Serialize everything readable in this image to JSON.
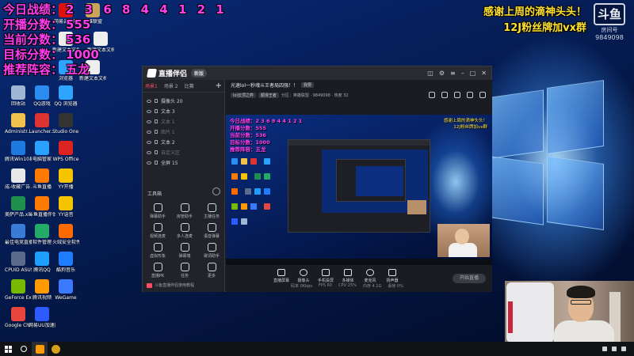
{
  "overlay_stats": [
    {
      "label": "今日战绩：",
      "value": "2 3 6 8 4 4 1 2 1"
    },
    {
      "label": "开播分数：",
      "value": "555"
    },
    {
      "label": "当前分数：",
      "value": "536"
    },
    {
      "label": "目标分数：",
      "value": "1000"
    },
    {
      "label": "推荐阵容：",
      "value": "五龙"
    }
  ],
  "overlay_thanks": [
    "感谢上周的滴神头头！",
    "12J粉丝牌加vx群"
  ],
  "watermark": {
    "brand": "斗鱼",
    "sub": "房间号",
    "room": "9849098"
  },
  "desktop_icons": [
    {
      "label": "回收站",
      "icon": "recycle-bin-icon",
      "color": "#9fb6d4"
    },
    {
      "label": "QQ游戏",
      "icon": "qq-game-icon",
      "color": "#2d8cf0"
    },
    {
      "label": "QQ 浏览器",
      "icon": "qq-browser-icon",
      "color": "#2fa4ff"
    },
    {
      "label": "Administr...",
      "icon": "user-folder-icon",
      "color": "#f0c14b"
    },
    {
      "label": "Launcher...",
      "icon": "launcher-icon",
      "color": "#d33"
    },
    {
      "label": "Studio One.exe",
      "icon": "studio-one-icon",
      "color": "#333"
    },
    {
      "label": "腾讯Win10易用",
      "icon": "tencent-icon",
      "color": "#1f7ae0"
    },
    {
      "label": "电脑管家",
      "icon": "pc-manager-icon",
      "color": "#2aa0ff"
    },
    {
      "label": "WPS Office",
      "icon": "wps-icon",
      "color": "#d22"
    },
    {
      "label": "成-收藏广告.xsks",
      "icon": "file-icon",
      "color": "#e8e8e8"
    },
    {
      "label": "斗鱼直播",
      "icon": "douyu-icon",
      "color": "#ff7a00"
    },
    {
      "label": "YY开播",
      "icon": "yy-icon",
      "color": "#f5c400"
    },
    {
      "label": "美萨产品.xls",
      "icon": "excel-icon",
      "color": "#1f8f4e"
    },
    {
      "label": "斗鱼直播伴侣",
      "icon": "douyu-companion-icon",
      "color": "#ff7a00"
    },
    {
      "label": "YY语音",
      "icon": "yy-voice-icon",
      "color": "#f5c400"
    },
    {
      "label": "最佳电竞直播产品库...022...",
      "icon": "doc-icon",
      "color": "#3a7bd5"
    },
    {
      "label": "软件管理",
      "icon": "software-icon",
      "color": "#22aa66"
    },
    {
      "label": "火绒安全软件",
      "icon": "huorong-icon",
      "color": "#ff6a00"
    },
    {
      "label": "CPUID ASUS CPU-Z",
      "icon": "cpuz-icon",
      "color": "#5a6b8c"
    },
    {
      "label": "腾讯QQ",
      "icon": "qq-icon",
      "color": "#1e9fff"
    },
    {
      "label": "酷狗音乐",
      "icon": "kugou-icon",
      "color": "#1e7cff"
    },
    {
      "label": "GeForce Experience",
      "icon": "geforce-icon",
      "color": "#76b900"
    },
    {
      "label": "腾讯视频",
      "icon": "tencent-video-icon",
      "color": "#ff9a00"
    },
    {
      "label": "WeGame",
      "icon": "wegame-icon",
      "color": "#3b79ff"
    },
    {
      "label": "Google Chrome",
      "icon": "chrome-icon",
      "color": "#e8453c"
    },
    {
      "label": "网易UU加速器",
      "icon": "uu-icon",
      "color": "#2d5bff"
    }
  ],
  "desktop_top_icons": [
    {
      "label": "网易云音乐",
      "color": "#d11"
    },
    {
      "label": "英雄联盟",
      "color": "#c9a45a"
    },
    {
      "label": "新建文本文档",
      "color": "#eee"
    },
    {
      "label": "新建文本文档",
      "color": "#eee"
    },
    {
      "label": "浏览器",
      "color": "#2fa4ff"
    },
    {
      "label": "新建文本文档",
      "color": "#eee"
    }
  ],
  "app": {
    "name": "直播伴侣",
    "version": "新版",
    "left_tabs": [
      "场景1",
      "场景 2",
      "比赛"
    ],
    "layers": [
      {
        "name": "摄像头 20",
        "dim": false
      },
      {
        "name": "文本 3",
        "dim": false
      },
      {
        "name": "文本 1",
        "dim": true
      },
      {
        "name": "图片 1",
        "dim": true
      },
      {
        "name": "文本 2",
        "dim": false
      },
      {
        "name": "自定义区",
        "dim": true
      },
      {
        "name": "全屏 15",
        "dim": false
      }
    ],
    "tools_title": "工具箱",
    "tools": [
      "弹幕助手",
      "房管助手",
      "主播任务",
      "视频连麦",
      "多人连麦",
      "语音弹幕",
      "虚拟形象",
      "弹幕墙",
      "歌词助手",
      "直播PK",
      "任务",
      "更多"
    ],
    "footer": "斗鱼直播伴侣使用教程",
    "room_title": "光速lol一秒魂斗王者局四强！！",
    "room_tag": "我要",
    "room_sub": [
      "lol云顶之弈",
      "顺滑王者"
    ],
    "room_meta": "分区：英雄联盟 · 9849098 · 热度 32",
    "bottom_buttons": [
      "直播屏幕",
      "摄像头",
      "手机投屏",
      "多媒体",
      "麦克风",
      "扬声器"
    ],
    "start_live": "开始直播",
    "status": [
      "码率 0Kbps",
      "FPS 60",
      "CPU 25%",
      "内存 4.1G",
      "丢帧 0%"
    ]
  },
  "taskbar_apps": [
    {
      "icon": "douyu-taskbar-icon",
      "color": "#ff9a00"
    },
    {
      "icon": "obs-taskbar-icon",
      "color": "#d4a017"
    }
  ]
}
